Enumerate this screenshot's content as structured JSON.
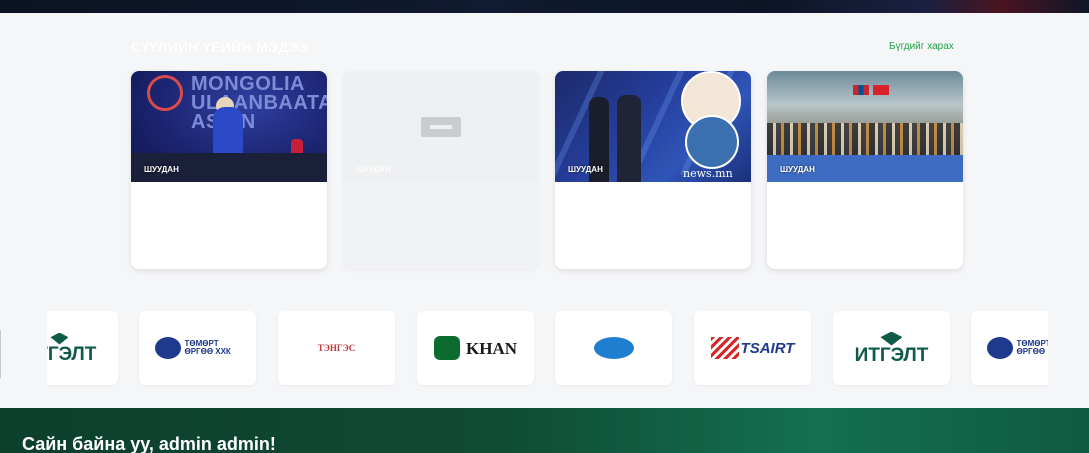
{
  "news": {
    "title": "СҮҮЛИЙН ҮЕИЙН МЭДЭЭ",
    "view_all": "Бүгдийг харах",
    "cards": [
      {
        "tag": "ШУУДАН",
        "image_banner": "MONGOLIA ULAANBAATAR ASIAN"
      },
      {
        "tag": "ШУУДАН"
      },
      {
        "tag": "ШУУДАН",
        "watermark": "news.mn"
      },
      {
        "tag": "ШУУДАН"
      }
    ]
  },
  "sponsors": [
    {
      "name": "ИТГЭЛТ",
      "icon": "itgelt-logo",
      "color": "#0f5a48"
    },
    {
      "name": "ТӨМӨРТ ӨРГӨӨ ХХК",
      "icon": "tumurt-urguu-logo",
      "color": "#1f3a8a"
    },
    {
      "name": "ТЭНГЭС",
      "icon": "tenges-logo",
      "color": "#c0393b"
    },
    {
      "name": "KHAN",
      "icon": "khan-bank-logo",
      "color": "#0d6b2f"
    },
    {
      "name": "",
      "icon": "globe-company-logo",
      "color": "#1e7fd0"
    },
    {
      "name": "TSAIRT",
      "icon": "tsairt-logo",
      "color": "#1f3a8a"
    },
    {
      "name": "ИТГЭЛТ",
      "icon": "itgelt-logo",
      "color": "#0f5a48"
    },
    {
      "name": "ТӨМӨРТ ӨРГӨӨ",
      "icon": "tumurt-urguu-logo",
      "color": "#1f3a8a"
    }
  ],
  "footer": {
    "greeting": "Сайн байна уу, admin admin!"
  }
}
